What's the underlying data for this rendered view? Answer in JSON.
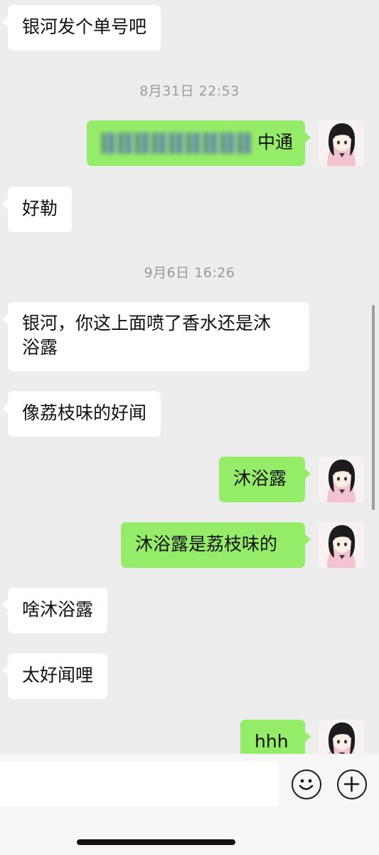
{
  "chat": {
    "messages": [
      {
        "side": "left",
        "text": "银河发个单号吧"
      },
      {
        "type": "time",
        "text": "8月31日 22:53"
      },
      {
        "side": "right",
        "redacted": true,
        "text": "中通"
      },
      {
        "side": "left",
        "text": "好勒"
      },
      {
        "type": "time",
        "text": "9月6日 16:26"
      },
      {
        "side": "left",
        "line1": "银河，你这上面喷了香水还是沐",
        "line2": "浴露"
      },
      {
        "side": "left",
        "text": "像荔枝味的好闻"
      },
      {
        "side": "right",
        "text": "沐浴露"
      },
      {
        "side": "right",
        "text": "沐浴露是荔枝味的"
      },
      {
        "side": "left",
        "text": "啥沐浴露"
      },
      {
        "side": "left",
        "text": "太好闻哩"
      },
      {
        "side": "right",
        "text": "hhh"
      }
    ]
  },
  "input_bar": {
    "emoji_icon": "smiley-face-icon",
    "plus_icon": "plus-circle-icon"
  },
  "colors": {
    "background": "#ededed",
    "sent_bubble": "#95ec69",
    "received_bubble": "#ffffff",
    "timestamp": "#9a9a9a"
  }
}
